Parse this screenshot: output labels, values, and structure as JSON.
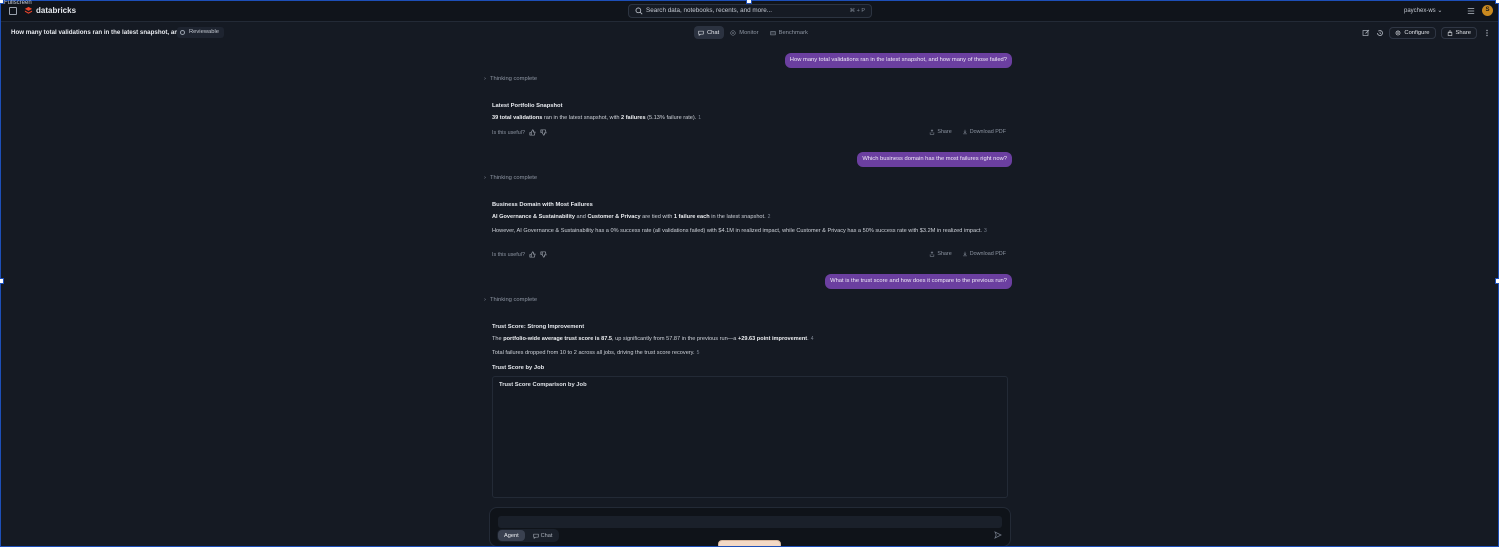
{
  "tiny_label": "Fullscreen",
  "topbar": {
    "brand": "databricks",
    "search_placeholder": "Search data, notebooks, recents, and more...",
    "search_shortcut": "⌘ + P",
    "workspace": "paychex-ws ⌄",
    "avatar_initial": "S"
  },
  "header": {
    "title": "How many total validations ran in the latest snapshot, and",
    "badge": "Reviewable",
    "tabs": [
      {
        "label": "Chat",
        "icon": "chat-bubble-icon",
        "active": true
      },
      {
        "label": "Monitor",
        "icon": "monitor-icon",
        "active": false
      },
      {
        "label": "Benchmark",
        "icon": "benchmark-icon",
        "active": false
      }
    ],
    "configure_label": "Configure",
    "share_label": "Share"
  },
  "conversation": {
    "turn1": {
      "question": "How many total validations ran in the latest snapshot, and how many of those failed?",
      "thinking": "Thinking complete",
      "title": "Latest Portfolio Snapshot",
      "text_bold_1": "39 total validations",
      "text_mid_1": " ran in the latest snapshot, with ",
      "text_bold_2": "2 failures",
      "text_tail": " (5.13% failure rate).",
      "cite": "1",
      "feedback": "Is this useful?",
      "share": "Share",
      "download": "Download PDF"
    },
    "turn2": {
      "question": "Which business domain has the most failures right now?",
      "thinking": "Thinking complete",
      "title": "Business Domain with Most Failures",
      "p1_bold_1": "AI Governance & Sustainability",
      "p1_mid": " and ",
      "p1_bold_2": "Customer & Privacy",
      "p1_mid2": " are tied with ",
      "p1_bold_3": "1 failure each",
      "p1_tail": " in the latest snapshot.",
      "p1_cite": "2",
      "p2": "However, AI Governance & Sustainability has a 0% success rate (all validations failed) with $4.1M in realized impact, while Customer & Privacy has a 50% success rate with $3.2M in realized impact.",
      "p2_cite": "3",
      "feedback": "Is this useful?",
      "share": "Share",
      "download": "Download PDF"
    },
    "turn3": {
      "question": "What is the trust score and how does it compare to the previous run?",
      "thinking": "Thinking complete",
      "title": "Trust Score: Strong Improvement",
      "p1_head": "The ",
      "p1_bold_1": "portfolio-wide average trust score is 87.5",
      "p1_mid": ", up significantly from 57.87 in the previous run—a ",
      "p1_bold_2": "+29.63 point improvement",
      "p1_tail": ".",
      "p1_cite": "4",
      "p2": "Total failures dropped from 10 to 2 across all jobs, driving the trust score recovery.",
      "p2_cite": "5",
      "section_title": "Trust Score by Job",
      "chart_title": "Trust Score Comparison by Job"
    }
  },
  "composer": {
    "placeholder": "",
    "tab_agent": "Agent",
    "tab_chat": "Chat"
  },
  "colors": {
    "user_bubble": "#6b3fa0",
    "background": "#151a23",
    "avatar": "#c9891f"
  }
}
